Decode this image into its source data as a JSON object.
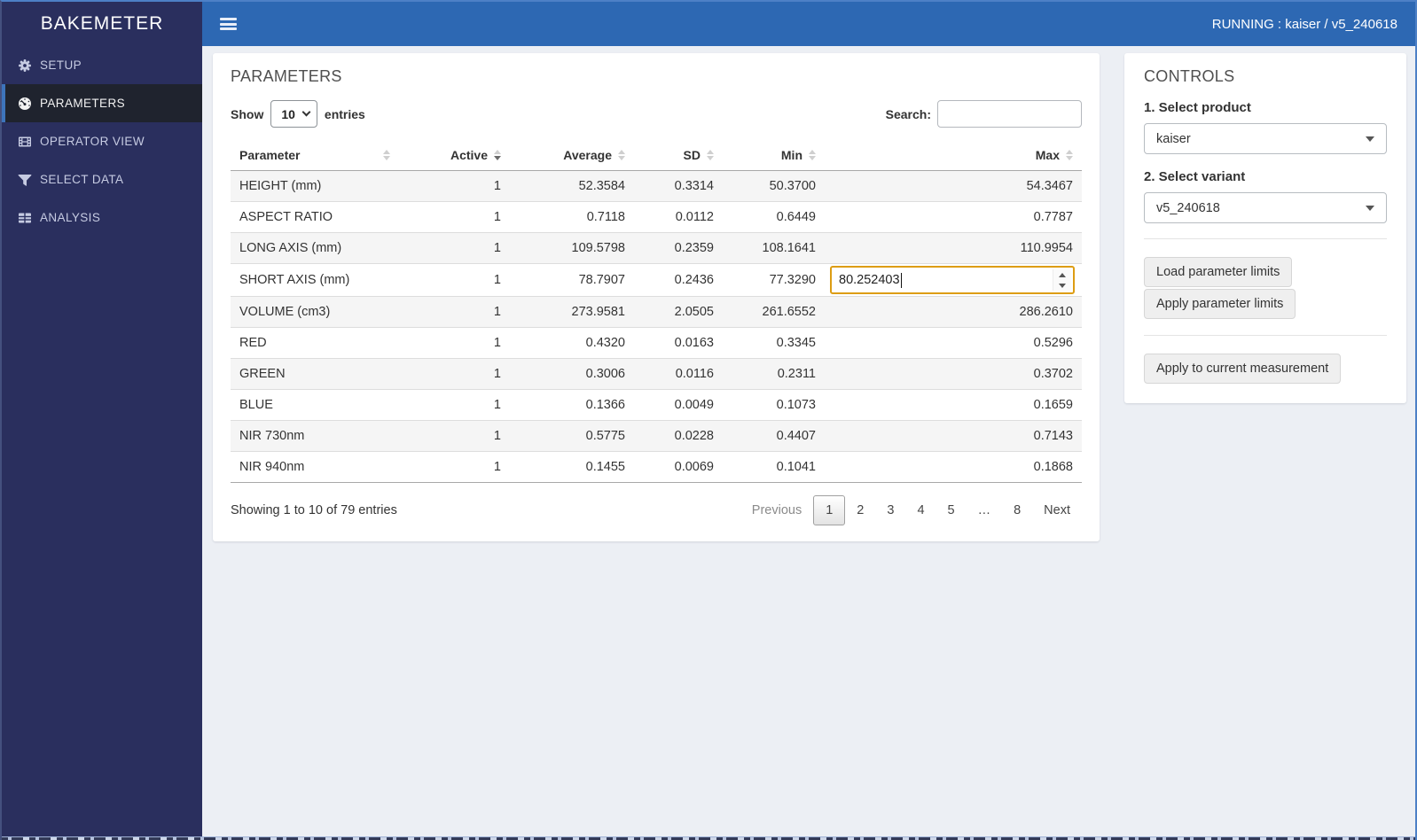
{
  "app": {
    "title": "BAKEMETER"
  },
  "topbar": {
    "menu_icon": "hamburger-menu-icon",
    "running_text": "RUNNING : kaiser / v5_240618"
  },
  "colors": {
    "topbar": "#2d68b3",
    "sidebar": "#2a2f5e",
    "sidebar_active": "#1f232e",
    "accent": "#3d74bb",
    "input_focus_border": "#dd9d13"
  },
  "sidebar": {
    "items": [
      {
        "label": "SETUP",
        "icon": "gear-icon",
        "active": false
      },
      {
        "label": "PARAMETERS",
        "icon": "gauge-icon",
        "active": true
      },
      {
        "label": "OPERATOR VIEW",
        "icon": "film-icon",
        "active": false
      },
      {
        "label": "SELECT DATA",
        "icon": "filter-icon",
        "active": false
      },
      {
        "label": "ANALYSIS",
        "icon": "table-icon",
        "active": false
      }
    ]
  },
  "parameters_panel": {
    "title": "PARAMETERS",
    "show_label": "Show",
    "page_length": "10",
    "entries_label": "entries",
    "search_label": "Search:",
    "search_value": "",
    "table": {
      "columns": [
        "Parameter",
        "Active",
        "Average",
        "SD",
        "Min",
        "Max"
      ],
      "sorted_column": "Active",
      "rows": [
        {
          "parameter": "HEIGHT (mm)",
          "active": "1",
          "average": "52.3584",
          "sd": "0.3314",
          "min": "50.3700",
          "max": "54.3467"
        },
        {
          "parameter": "ASPECT RATIO",
          "active": "1",
          "average": "0.7118",
          "sd": "0.0112",
          "min": "0.6449",
          "max": "0.7787"
        },
        {
          "parameter": "LONG AXIS (mm)",
          "active": "1",
          "average": "109.5798",
          "sd": "0.2359",
          "min": "108.1641",
          "max": "110.9954"
        },
        {
          "parameter": "SHORT AXIS (mm)",
          "active": "1",
          "average": "78.7907",
          "sd": "0.2436",
          "min": "77.3290",
          "max_input": "80.252403"
        },
        {
          "parameter": "VOLUME (cm3)",
          "active": "1",
          "average": "273.9581",
          "sd": "2.0505",
          "min": "261.6552",
          "max": "286.2610"
        },
        {
          "parameter": "RED",
          "active": "1",
          "average": "0.4320",
          "sd": "0.0163",
          "min": "0.3345",
          "max": "0.5296"
        },
        {
          "parameter": "GREEN",
          "active": "1",
          "average": "0.3006",
          "sd": "0.0116",
          "min": "0.2311",
          "max": "0.3702"
        },
        {
          "parameter": "BLUE",
          "active": "1",
          "average": "0.1366",
          "sd": "0.0049",
          "min": "0.1073",
          "max": "0.1659"
        },
        {
          "parameter": "NIR 730nm",
          "active": "1",
          "average": "0.5775",
          "sd": "0.0228",
          "min": "0.4407",
          "max": "0.7143"
        },
        {
          "parameter": "NIR 940nm",
          "active": "1",
          "average": "0.1455",
          "sd": "0.0069",
          "min": "0.1041",
          "max": "0.1868"
        }
      ]
    },
    "footer": {
      "info": "Showing 1 to 10 of 79 entries",
      "previous_label": "Previous",
      "pages": [
        "1",
        "2",
        "3",
        "4",
        "5",
        "…",
        "8"
      ],
      "current_page": "1",
      "next_label": "Next"
    }
  },
  "controls_panel": {
    "title": "CONTROLS",
    "product_label": "1. Select product",
    "product_value": "kaiser",
    "variant_label": "2. Select variant",
    "variant_value": "v5_240618",
    "buttons": {
      "load_limits": "Load parameter limits",
      "apply_limits": "Apply parameter limits",
      "apply_current": "Apply to current measurement"
    }
  }
}
